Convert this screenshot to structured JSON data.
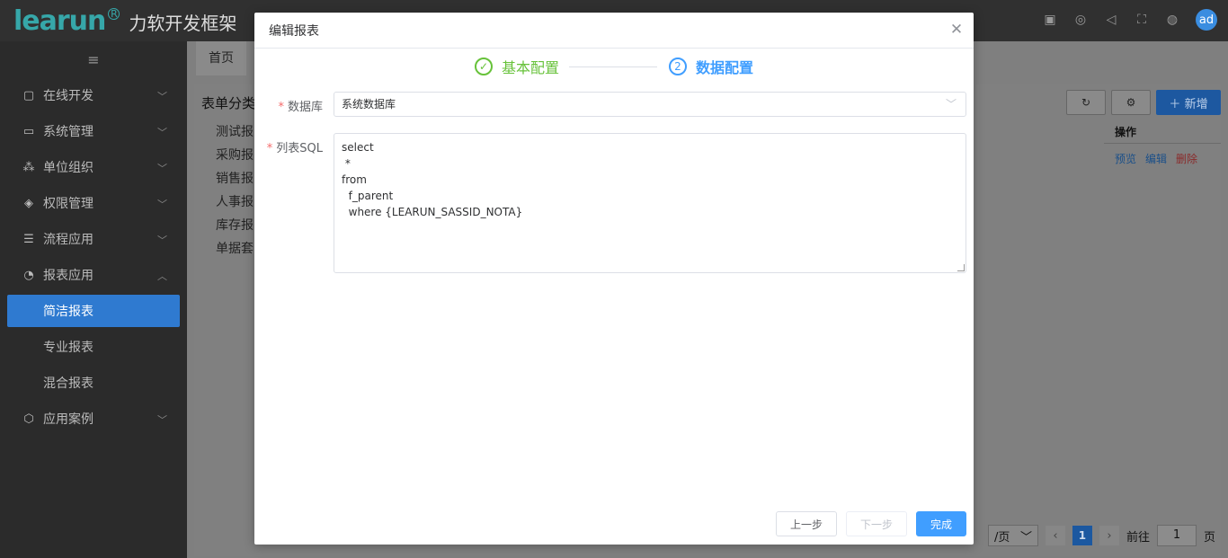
{
  "app": {
    "logo_word": "learun",
    "logo_reg": "R",
    "logo_cn": "力软开发框架",
    "avatar": "ad"
  },
  "sidebar": {
    "items": [
      {
        "label": "在线开发",
        "icon": "code-icon"
      },
      {
        "label": "系统管理",
        "icon": "monitor-icon"
      },
      {
        "label": "单位组织",
        "icon": "org-icon"
      },
      {
        "label": "权限管理",
        "icon": "shield-icon"
      },
      {
        "label": "流程应用",
        "icon": "flow-icon"
      },
      {
        "label": "报表应用",
        "icon": "pie-icon"
      }
    ],
    "sub_items": [
      "简洁报表",
      "专业报表",
      "混合报表"
    ],
    "last_item": {
      "label": "应用案例",
      "icon": "box-icon"
    }
  },
  "main": {
    "tab_home": "首页",
    "category_title": "表单分类",
    "categories": [
      "测试报",
      "采购报",
      "销售报",
      "人事报",
      "库存报",
      "单据套"
    ],
    "add_label": "新增",
    "col_ops": "操作",
    "row_ops": {
      "preview": "预览",
      "edit": "编辑",
      "delete": "删除"
    },
    "pager": {
      "size": "/页",
      "page": "1",
      "goto": "前往",
      "goto_value": "1",
      "suffix": "页"
    }
  },
  "modal": {
    "title": "编辑报表",
    "steps": [
      {
        "num": "✓",
        "label": "基本配置",
        "state": "finished",
        "color": "#67c23a"
      },
      {
        "num": "2",
        "label": "数据配置",
        "state": "active",
        "color": "#409eff"
      }
    ],
    "db_label": "数据库",
    "db_value": "系统数据库",
    "sql_label": "列表SQL",
    "sql_value": "select\n *\nfrom\n  f_parent\n  where {LEARUN_SASSID_NOTA}",
    "btn_prev": "上一步",
    "btn_next": "下一步",
    "btn_finish": "完成"
  }
}
